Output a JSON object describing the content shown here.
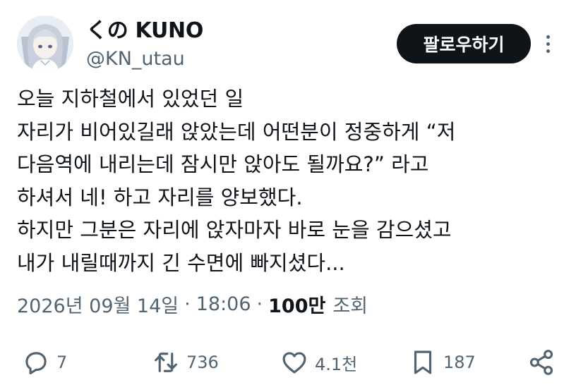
{
  "user": {
    "display_name": "くの KUNO",
    "handle": "@KN_utau"
  },
  "follow_button_label": "팔로우하기",
  "tweet": {
    "lines": [
      "오늘 지하철에서 있었던 일",
      "자리가 비어있길래 앉았는데 어떤분이 정중하게 “저",
      "다음역에 내리는데 잠시만 앉아도 될까요?” 라고",
      "하셔서 네! 하고 자리를 양보했다.",
      "하지만 그분은 자리에 앉자마자 바로 눈을 감으셨고",
      "내가 내릴때까지 긴 수면에 빠지셨다..."
    ]
  },
  "meta": {
    "date": "2026년 09월 14일",
    "separator": "·",
    "time": "18:06",
    "views_count": "100만",
    "views_label": "조회"
  },
  "actions": {
    "replies": "7",
    "retweets": "736",
    "likes": "4.1천",
    "bookmarks": "187"
  },
  "icons": {
    "more": "more-vertical-icon",
    "reply": "reply-icon",
    "retweet": "retweet-icon",
    "like": "heart-icon",
    "bookmark": "bookmark-icon",
    "share": "share-icon"
  }
}
